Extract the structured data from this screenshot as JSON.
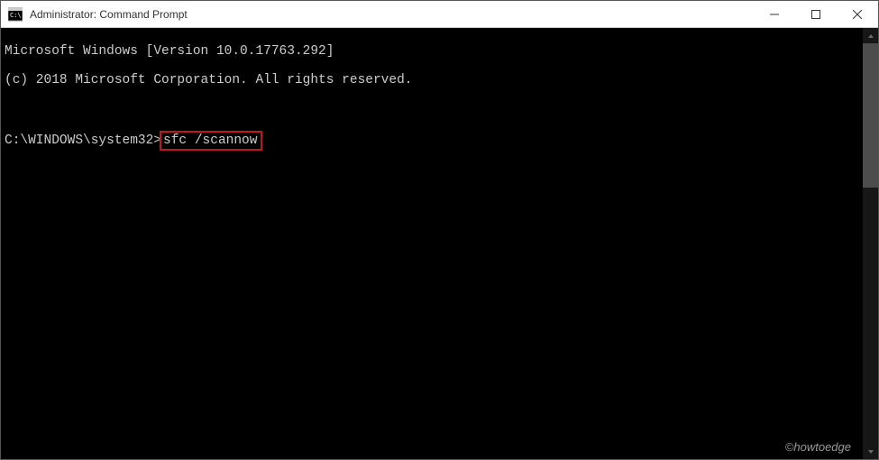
{
  "titlebar": {
    "title": "Administrator: Command Prompt"
  },
  "terminal": {
    "line1": "Microsoft Windows [Version 10.0.17763.292]",
    "line2": "(c) 2018 Microsoft Corporation. All rights reserved.",
    "prompt": "C:\\WINDOWS\\system32>",
    "command": "sfc /scannow"
  },
  "watermark": "©howtoedge"
}
